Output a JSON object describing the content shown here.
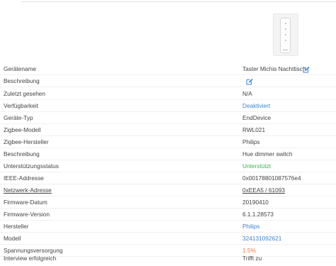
{
  "rows": [
    {
      "label": "Gerätename",
      "value": "Taster Michis Nachttisch",
      "color": "#444444"
    },
    {
      "label": "Beschreibung",
      "value": "",
      "color": "#444444"
    },
    {
      "label": "Zuletzt gesehen",
      "value": "N/A",
      "color": "#444444"
    },
    {
      "label": "Verfügbarkeit",
      "value": "Deaktiviert",
      "color": "#3a84d4"
    },
    {
      "label": "Geräte-Typ",
      "value": "EndDevice",
      "color": "#444444"
    },
    {
      "label": "Zigbee-Modell",
      "value": "RWL021",
      "color": "#444444"
    },
    {
      "label": "Zigbee-Hersteller",
      "value": "Philips",
      "color": "#444444"
    },
    {
      "label": "Beschreibung",
      "value": "Hue dimmer switch",
      "color": "#444444"
    },
    {
      "label": "Unterstützungsstatus",
      "value": "Unterstützt",
      "color": "#3db54a"
    },
    {
      "label": "IEEE-Addresse",
      "value": "0x00178801087576e4",
      "color": "#444444"
    },
    {
      "label": "Netzwerk-Adresse",
      "value": "0xEEA5 / 61093",
      "color": "#444444"
    },
    {
      "label": "Firmware-Datum",
      "value": "20190410",
      "color": "#444444"
    },
    {
      "label": "Firmware-Version",
      "value": "6.1.1.28573",
      "color": "#444444"
    },
    {
      "label": "Hersteller",
      "value": "Philips",
      "color": "#3a84d4"
    },
    {
      "label": "Modell",
      "value": "324131092621",
      "color": "#3a84d4"
    },
    {
      "label": "Spannungsversorgung",
      "value": "1.5%",
      "color": "#ee7a3f"
    },
    {
      "label": "Interview erfolgreich",
      "value": "Trifft zu",
      "color": "#444444"
    }
  ],
  "icons": {
    "edit_name": "edit-icon",
    "edit_description": "edit-icon",
    "device_image": "hue-dimmer-switch-image"
  },
  "colors": {
    "link": "#3a84d4",
    "success": "#3db54a",
    "warning": "#ee7a3f",
    "text": "#444444"
  }
}
